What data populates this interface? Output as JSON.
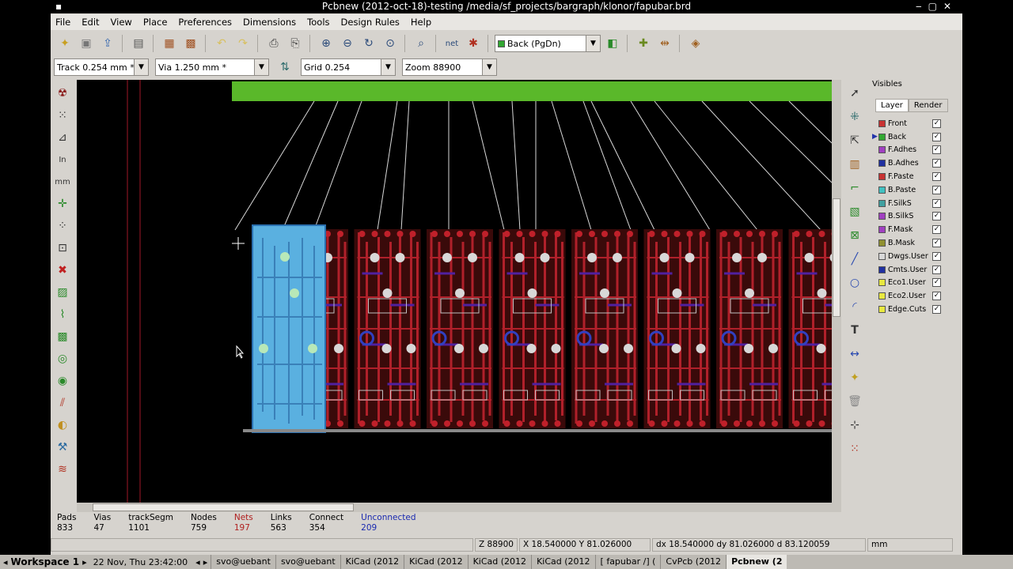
{
  "window": {
    "title": "Pcbnew (2012-oct-18)-testing /media/sf_projects/bargraph/klonor/fapubar.brd"
  },
  "menu": [
    "File",
    "Edit",
    "View",
    "Place",
    "Preferences",
    "Dimensions",
    "Tools",
    "Design Rules",
    "Help"
  ],
  "toolbar": {
    "layer_select": "Back (PgDn)",
    "track": "Track 0.254 mm *",
    "via": "Via 1.250 mm *",
    "grid": "Grid 0.254",
    "zoom": "Zoom 88900"
  },
  "visibles": {
    "title": "Visibles",
    "tabs": [
      "Layer",
      "Render"
    ],
    "layers": [
      {
        "name": "Front",
        "color": "#c83232"
      },
      {
        "name": "Back",
        "color": "#32a832"
      },
      {
        "name": "F.Adhes",
        "color": "#a040c0"
      },
      {
        "name": "B.Adhes",
        "color": "#2030a0"
      },
      {
        "name": "F.Paste",
        "color": "#c83232"
      },
      {
        "name": "B.Paste",
        "color": "#40c0c0"
      },
      {
        "name": "F.SilkS",
        "color": "#40a0a0"
      },
      {
        "name": "B.SilkS",
        "color": "#a040c0"
      },
      {
        "name": "F.Mask",
        "color": "#a040c0"
      },
      {
        "name": "B.Mask",
        "color": "#909030"
      },
      {
        "name": "Dwgs.User",
        "color": "#d8d8d8"
      },
      {
        "name": "Cmts.User",
        "color": "#2030a0"
      },
      {
        "name": "Eco1.User",
        "color": "#e8e840"
      },
      {
        "name": "Eco2.User",
        "color": "#e8e840"
      },
      {
        "name": "Edge.Cuts",
        "color": "#e8e840"
      }
    ]
  },
  "stats": [
    {
      "label": "Pads",
      "value": "833",
      "color": "#000000",
      "vcolor": "#000000"
    },
    {
      "label": "Vias",
      "value": "47",
      "color": "#000000",
      "vcolor": "#000000"
    },
    {
      "label": "trackSegm",
      "value": "1101",
      "color": "#000000",
      "vcolor": "#000000"
    },
    {
      "label": "Nodes",
      "value": "759",
      "color": "#000000",
      "vcolor": "#000000"
    },
    {
      "label": "Nets",
      "value": "197",
      "color": "#b02020",
      "vcolor": "#b02020"
    },
    {
      "label": "Links",
      "value": "563",
      "color": "#000000",
      "vcolor": "#000000"
    },
    {
      "label": "Connect",
      "value": "354",
      "color": "#000000",
      "vcolor": "#000000"
    },
    {
      "label": "Unconnected",
      "value": "209",
      "color": "#1a2ab0",
      "vcolor": "#1a2ab0"
    }
  ],
  "status": {
    "zoom": "Z 88900",
    "xy": "X 18.540000  Y 81.026000",
    "delta": "dx 18.540000  dy 81.026000  d 83.120059",
    "units": "mm"
  },
  "taskbar": {
    "workspace": "Workspace 1",
    "clock": "22 Nov, Thu 23:42:00",
    "tasks": [
      "svo@uebant",
      "svo@uebant",
      "KiCad (2012",
      "KiCad (2012",
      "KiCad (2012",
      "KiCad (2012",
      "[ fapubar /] (",
      "CvPcb (2012",
      "Pcbnew (2"
    ]
  }
}
